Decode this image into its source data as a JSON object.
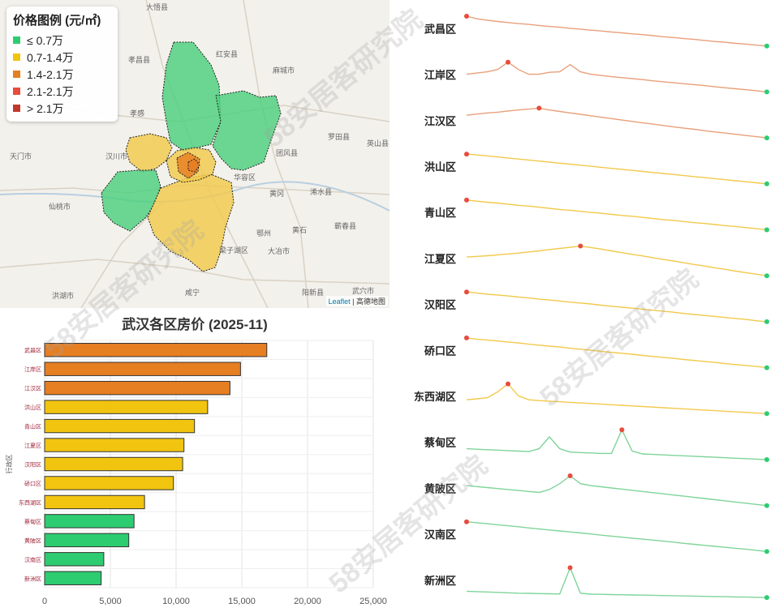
{
  "legend": {
    "title": "价格图例 (元/㎡)",
    "items": [
      {
        "label": "≤ 0.7万",
        "color": "#2ecc71"
      },
      {
        "label": "0.7-1.4万",
        "color": "#f1c40f"
      },
      {
        "label": "1.4-2.1万",
        "color": "#e67e22"
      },
      {
        "label": "2.1-2.1万",
        "color": "#e74c3c"
      },
      {
        "label": "> 2.1万",
        "color": "#c0392b"
      }
    ]
  },
  "map": {
    "attribution_leaflet": "Leaflet",
    "attribution_source": "| 高德地图",
    "place_labels": [
      "大悟县",
      "红安县",
      "孝昌县",
      "麻城市",
      "孝感",
      "汉川市",
      "天门市",
      "仙桃市",
      "团风县",
      "黄冈",
      "浠水县",
      "英山县",
      "罗田县",
      "鄂州",
      "黄石",
      "大冶市",
      "梁子湖区",
      "咸宁",
      "阳新县",
      "武穴市",
      "蕲春县",
      "洪湖市",
      "华容区"
    ]
  },
  "watermark": "58安居客研究院",
  "chart_data": {
    "type": "bar",
    "orientation": "horizontal",
    "title": "武汉各区房价 (2025-11)",
    "ylabel": "行政区",
    "xlabel": "",
    "xlim": [
      0,
      25000
    ],
    "xticks": [
      "0",
      "5,000",
      "10,000",
      "15,000",
      "20,000",
      "25,000"
    ],
    "grid": true,
    "categories": [
      "武昌区",
      "江岸区",
      "江汉区",
      "洪山区",
      "青山区",
      "江夏区",
      "汉阳区",
      "硚口区",
      "东西湖区",
      "蔡甸区",
      "黄陂区",
      "汉南区",
      "新洲区"
    ],
    "values": [
      16900,
      14900,
      14100,
      12400,
      11400,
      10600,
      10500,
      9800,
      7600,
      6800,
      6400,
      4500,
      4300
    ],
    "colors": [
      "#e67e22",
      "#e67e22",
      "#e67e22",
      "#f1c40f",
      "#f1c40f",
      "#f1c40f",
      "#f1c40f",
      "#f1c40f",
      "#f1c40f",
      "#2ecc71",
      "#2ecc71",
      "#2ecc71",
      "#2ecc71"
    ],
    "sparklines": [
      {
        "name": "武昌区",
        "color": "#e8a07a",
        "values": [
          100,
          99,
          98.5,
          98,
          97.6,
          97.2,
          96.9,
          96.5,
          96.1,
          95.8,
          95.4,
          95.1,
          94.7,
          94.4,
          94.0,
          93.7,
          93.3,
          93.0,
          92.6,
          92.2,
          91.9,
          91.5,
          91.2,
          90.8,
          90.4,
          90.1,
          89.7,
          89.4,
          89.0,
          88.7
        ]
      },
      {
        "name": "江岸区",
        "color": "#e8a07a",
        "values": [
          95,
          95.5,
          96,
          97,
          100,
          97,
          95,
          95,
          95.8,
          96,
          99,
          96,
          95,
          94.5,
          94,
          93.6,
          93.2,
          92.8,
          92.3,
          91.9,
          91.5,
          91.1,
          90.7,
          90.3,
          89.8,
          89.4,
          89,
          88.6,
          88.2,
          87.7
        ]
      },
      {
        "name": "江汉区",
        "color": "#e8a07a",
        "values": [
          97,
          97.5,
          98,
          98.3,
          98.8,
          99.2,
          99.6,
          100,
          99.2,
          98.6,
          98,
          97.4,
          96.8,
          96.2,
          95.6,
          95,
          94.4,
          93.8,
          93.3,
          92.7,
          92.1,
          91.6,
          91.1,
          90.5,
          90,
          89.5,
          89,
          88.5,
          88,
          87.5
        ]
      },
      {
        "name": "洪山区",
        "color": "#f2c94c",
        "values": [
          100,
          99.7,
          99.3,
          98.9,
          98.5,
          98.1,
          97.7,
          97.3,
          96.9,
          96.5,
          96.1,
          95.7,
          95.3,
          94.9,
          94.5,
          94.1,
          93.7,
          93.3,
          92.9,
          92.5,
          92.1,
          91.7,
          91.3,
          90.9,
          90.5,
          90.1,
          89.7,
          89.3,
          88.9,
          88.5
        ]
      },
      {
        "name": "青山区",
        "color": "#f2c94c",
        "values": [
          100,
          99.6,
          99.2,
          98.9,
          98.5,
          98.1,
          97.8,
          97.4,
          97.0,
          96.6,
          96.3,
          95.9,
          95.5,
          95.2,
          94.8,
          94.4,
          94.1,
          93.7,
          93.3,
          92.9,
          92.6,
          92.2,
          91.8,
          91.5,
          91.1,
          90.7,
          90.4,
          90.0,
          89.6,
          89.2
        ]
      },
      {
        "name": "江夏区",
        "color": "#f2c94c",
        "values": [
          95,
          95.3,
          95.6,
          96,
          96.4,
          96.8,
          97.3,
          97.8,
          98.4,
          98.9,
          99.4,
          100,
          99.3,
          98.6,
          97.8,
          97,
          96.2,
          95.5,
          94.7,
          93.9,
          93.2,
          92.4,
          91.6,
          90.9,
          90.1,
          89.4,
          88.6,
          87.9,
          87.2,
          86.5
        ]
      },
      {
        "name": "汉阳区",
        "color": "#f2c94c",
        "values": [
          100,
          99.6,
          99.1,
          98.8,
          98.4,
          98.0,
          97.6,
          97.1,
          96.8,
          96.4,
          95.9,
          95.6,
          95.2,
          94.7,
          94.3,
          93.9,
          93.5,
          93.1,
          92.7,
          92.3,
          91.9,
          91.4,
          91.0,
          90.6,
          90.2,
          89.8,
          89.4,
          89.0,
          88.5,
          88.1
        ]
      },
      {
        "name": "硚口区",
        "color": "#f2c94c",
        "values": [
          100,
          99.5,
          99.1,
          98.7,
          98.3,
          97.9,
          97.4,
          97.0,
          96.6,
          96.2,
          95.7,
          95.3,
          94.9,
          94.4,
          94.0,
          93.6,
          93.2,
          92.7,
          92.3,
          91.9,
          91.5,
          91.0,
          90.6,
          90.2,
          89.8,
          89.3,
          88.9,
          88.5,
          88.1,
          87.6
        ]
      },
      {
        "name": "东西湖区",
        "color": "#f2c94c",
        "values": [
          92,
          92.5,
          93,
          96,
          100,
          94,
          92,
          91.6,
          91.3,
          91,
          90.7,
          90.4,
          90.1,
          89.8,
          89.5,
          89.2,
          88.9,
          88.6,
          88.3,
          88,
          87.7,
          87.4,
          87.1,
          86.8,
          86.5,
          86.2,
          85.9,
          85.6,
          85.3,
          85
        ]
      },
      {
        "name": "蔡甸区",
        "color": "#7fd49a",
        "values": [
          92,
          91.8,
          91.6,
          91.4,
          91.2,
          91,
          90.8,
          92,
          97,
          92,
          90.6,
          90.4,
          90.2,
          90,
          90,
          100,
          91,
          89.8,
          89.6,
          89.4,
          89.2,
          89,
          88.8,
          88.6,
          88.4,
          88.2,
          88,
          87.8,
          87.6,
          87.4
        ]
      },
      {
        "name": "黄陂区",
        "color": "#7fd49a",
        "values": [
          95,
          94.5,
          94,
          93.5,
          93,
          92.5,
          92,
          91.5,
          93,
          96,
          100,
          96,
          95,
          94.4,
          93.8,
          93.2,
          92.6,
          92,
          91.4,
          90.8,
          90.2,
          89.6,
          89,
          88.4,
          87.8,
          87.2,
          86.6,
          86,
          85.4,
          84.8
        ]
      },
      {
        "name": "汉南区",
        "color": "#7fd49a",
        "values": [
          100,
          99.6,
          99.2,
          98.8,
          98.4,
          98,
          97.5,
          97.1,
          96.7,
          96.3,
          95.9,
          95.5,
          95.1,
          94.6,
          94.2,
          93.8,
          93.4,
          93,
          92.6,
          92.2,
          91.8,
          91.3,
          90.9,
          90.5,
          90.1,
          89.7,
          89.3,
          88.9,
          88.5,
          88
        ]
      },
      {
        "name": "新洲区",
        "color": "#7fd49a",
        "values": [
          88,
          87.8,
          87.6,
          87.4,
          87.2,
          87,
          86.9,
          86.8,
          86.7,
          86.6,
          100,
          87,
          86.5,
          86.4,
          86.3,
          86.2,
          86.1,
          86,
          85.9,
          85.8,
          85.7,
          85.6,
          85.5,
          85.4,
          85.3,
          85.2,
          85.1,
          85,
          84.9,
          84.8
        ]
      }
    ],
    "spark_start_color": "#e74c3c",
    "spark_end_color": "#2ecc71"
  }
}
